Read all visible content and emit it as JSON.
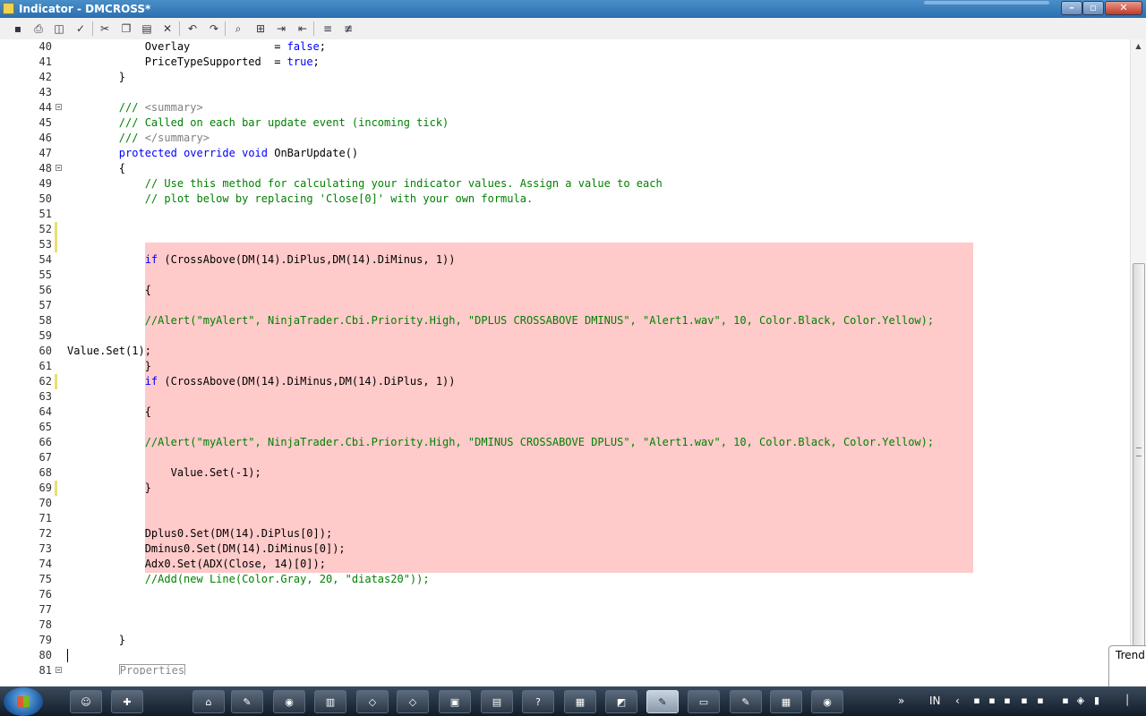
{
  "window": {
    "title": "Indicator - DMCROSS*"
  },
  "toolbar": {
    "buttons": [
      {
        "name": "save-icon",
        "glyph": "▪"
      },
      {
        "name": "print-icon",
        "glyph": "⎙"
      },
      {
        "name": "print-preview-icon",
        "glyph": "◫"
      },
      {
        "name": "compile-icon",
        "glyph": "✓"
      },
      {
        "name": "cut-icon",
        "glyph": "✂"
      },
      {
        "name": "copy-icon",
        "glyph": "❐"
      },
      {
        "name": "paste-icon",
        "glyph": "▤"
      },
      {
        "name": "delete-icon",
        "glyph": "✕"
      },
      {
        "name": "undo-icon",
        "glyph": "↶"
      },
      {
        "name": "redo-icon",
        "glyph": "↷"
      },
      {
        "name": "find-icon",
        "glyph": "⌕"
      },
      {
        "name": "replace-icon",
        "glyph": "⊞"
      },
      {
        "name": "indent-icon",
        "glyph": "⇥"
      },
      {
        "name": "outdent-icon",
        "glyph": "⇤"
      },
      {
        "name": "comment-icon",
        "glyph": "≡"
      },
      {
        "name": "uncomment-icon",
        "glyph": "≢"
      }
    ]
  },
  "editor": {
    "lines": [
      {
        "n": "40",
        "fold": false,
        "chg": false,
        "t": "            Overlay             = false;"
      },
      {
        "n": "41",
        "fold": false,
        "chg": false,
        "t": "            PriceTypeSupported  = true;"
      },
      {
        "n": "42",
        "fold": false,
        "chg": false,
        "t": "        }"
      },
      {
        "n": "43",
        "fold": false,
        "chg": false,
        "t": ""
      },
      {
        "n": "44",
        "fold": true,
        "chg": false,
        "t": "        /// <summary>"
      },
      {
        "n": "45",
        "fold": false,
        "chg": false,
        "t": "        /// Called on each bar update event (incoming tick)"
      },
      {
        "n": "46",
        "fold": false,
        "chg": false,
        "t": "        /// </summary>"
      },
      {
        "n": "47",
        "fold": false,
        "chg": false,
        "t": "        protected override void OnBarUpdate()"
      },
      {
        "n": "48",
        "fold": true,
        "chg": false,
        "t": "        {"
      },
      {
        "n": "49",
        "fold": false,
        "chg": false,
        "t": "            // Use this method for calculating your indicator values. Assign a value to each"
      },
      {
        "n": "50",
        "fold": false,
        "chg": false,
        "t": "            // plot below by replacing 'Close[0]' with your own formula."
      },
      {
        "n": "51",
        "fold": false,
        "chg": false,
        "t": ""
      },
      {
        "n": "52",
        "fold": false,
        "chg": true,
        "t": ""
      },
      {
        "n": "53",
        "fold": false,
        "chg": true,
        "t": ""
      },
      {
        "n": "54",
        "fold": false,
        "chg": false,
        "t": "            if (CrossAbove(DM(14).DiPlus,DM(14).DiMinus, 1))"
      },
      {
        "n": "55",
        "fold": false,
        "chg": false,
        "t": ""
      },
      {
        "n": "56",
        "fold": false,
        "chg": false,
        "t": "            {"
      },
      {
        "n": "57",
        "fold": false,
        "chg": false,
        "t": ""
      },
      {
        "n": "58",
        "fold": false,
        "chg": false,
        "t": "            //Alert(\"myAlert\", NinjaTrader.Cbi.Priority.High, \"DPLUS CROSSABOVE DMINUS\", \"Alert1.wav\", 10, Color.Black, Color.Yellow);"
      },
      {
        "n": "59",
        "fold": false,
        "chg": false,
        "t": ""
      },
      {
        "n": "60",
        "fold": false,
        "chg": false,
        "t": "Value.Set(1);"
      },
      {
        "n": "61",
        "fold": false,
        "chg": false,
        "t": "            }"
      },
      {
        "n": "62",
        "fold": false,
        "chg": true,
        "t": "            if (CrossAbove(DM(14).DiMinus,DM(14).DiPlus, 1))"
      },
      {
        "n": "63",
        "fold": false,
        "chg": false,
        "t": ""
      },
      {
        "n": "64",
        "fold": false,
        "chg": false,
        "t": "            {"
      },
      {
        "n": "65",
        "fold": false,
        "chg": false,
        "t": ""
      },
      {
        "n": "66",
        "fold": false,
        "chg": false,
        "t": "            //Alert(\"myAlert\", NinjaTrader.Cbi.Priority.High, \"DMINUS CROSSABOVE DPLUS\", \"Alert1.wav\", 10, Color.Black, Color.Yellow);"
      },
      {
        "n": "67",
        "fold": false,
        "chg": false,
        "t": ""
      },
      {
        "n": "68",
        "fold": false,
        "chg": false,
        "t": "                Value.Set(-1);"
      },
      {
        "n": "69",
        "fold": false,
        "chg": true,
        "t": "            }"
      },
      {
        "n": "70",
        "fold": false,
        "chg": false,
        "t": ""
      },
      {
        "n": "71",
        "fold": false,
        "chg": false,
        "t": ""
      },
      {
        "n": "72",
        "fold": false,
        "chg": false,
        "t": "            Dplus0.Set(DM(14).DiPlus[0]);"
      },
      {
        "n": "73",
        "fold": false,
        "chg": false,
        "t": "            Dminus0.Set(DM(14).DiMinus[0]);"
      },
      {
        "n": "74",
        "fold": false,
        "chg": false,
        "t": "            Adx0.Set(ADX(Close, 14)[0]);"
      },
      {
        "n": "75",
        "fold": false,
        "chg": false,
        "t": "            //Add(new Line(Color.Gray, 20, \"diatas20\"));"
      },
      {
        "n": "76",
        "fold": false,
        "chg": false,
        "t": ""
      },
      {
        "n": "77",
        "fold": false,
        "chg": false,
        "t": ""
      },
      {
        "n": "78",
        "fold": false,
        "chg": false,
        "t": ""
      },
      {
        "n": "79",
        "fold": false,
        "chg": false,
        "t": "        }"
      },
      {
        "n": "80",
        "fold": false,
        "chg": false,
        "t": ""
      },
      {
        "n": "81",
        "fold": true,
        "chg": false,
        "t": "        Properties"
      }
    ],
    "caret_line": "80",
    "region_label": "Properties"
  },
  "side_panel": {
    "tab_label": "Trend"
  },
  "taskbar": {
    "items": [
      {
        "name": "taskbar-item-1",
        "glyph": "☺",
        "active": false
      },
      {
        "name": "taskbar-item-2",
        "glyph": "✚",
        "active": false
      },
      {
        "name": "taskbar-item-3",
        "glyph": "⌂",
        "active": false
      },
      {
        "name": "taskbar-item-4",
        "glyph": "✎",
        "active": false
      },
      {
        "name": "taskbar-item-firefox-1",
        "glyph": "◉",
        "active": false
      },
      {
        "name": "taskbar-item-6",
        "glyph": "▥",
        "active": false
      },
      {
        "name": "taskbar-item-7",
        "glyph": "◇",
        "active": false
      },
      {
        "name": "taskbar-item-8",
        "glyph": "◇",
        "active": false
      },
      {
        "name": "taskbar-item-9",
        "glyph": "▣",
        "active": false
      },
      {
        "name": "taskbar-item-10",
        "glyph": "▤",
        "active": false
      },
      {
        "name": "taskbar-item-11",
        "glyph": "?",
        "active": false
      },
      {
        "name": "taskbar-item-12",
        "glyph": "▦",
        "active": false
      },
      {
        "name": "taskbar-item-13",
        "glyph": "◩",
        "active": false
      },
      {
        "name": "taskbar-item-indicator",
        "glyph": "✎",
        "active": true
      },
      {
        "name": "taskbar-item-15",
        "glyph": "▭",
        "active": false
      },
      {
        "name": "taskbar-item-16",
        "glyph": "✎",
        "active": false
      },
      {
        "name": "taskbar-item-17",
        "glyph": "▦",
        "active": false
      },
      {
        "name": "taskbar-item-firefox-2",
        "glyph": "◉",
        "active": false
      }
    ],
    "language": "IN",
    "overflow": "»",
    "tray_chevron": "‹"
  }
}
